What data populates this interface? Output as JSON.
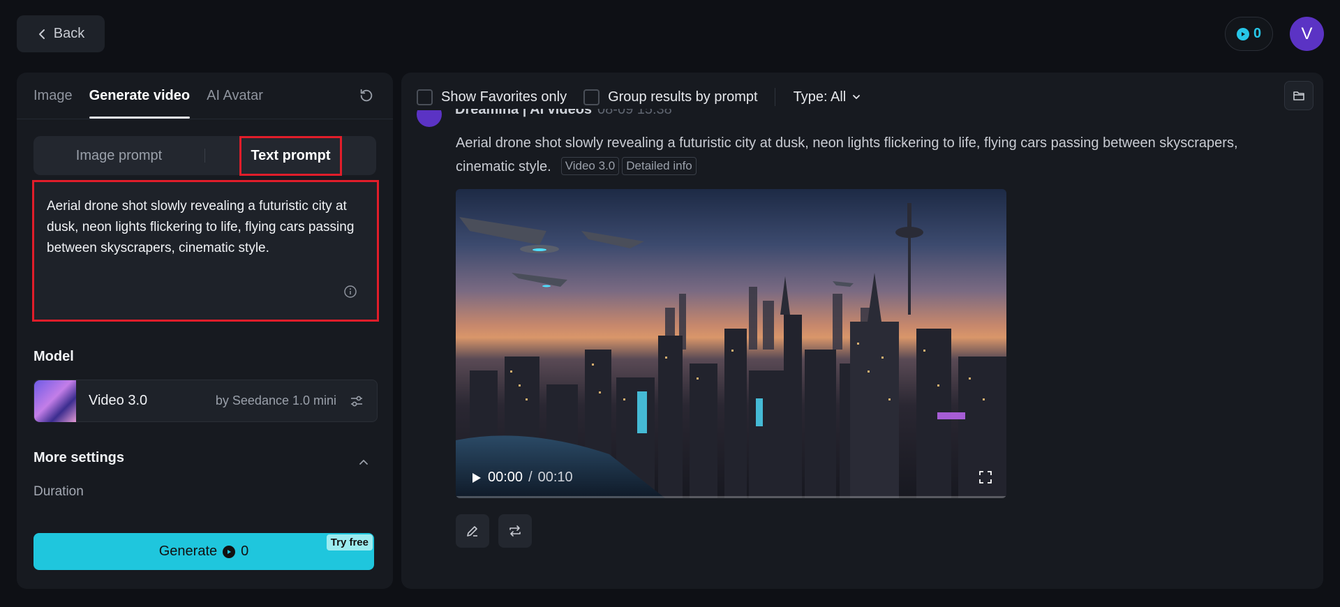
{
  "topbar": {
    "back_label": "Back",
    "credits": "0",
    "avatar_letter": "V"
  },
  "left": {
    "tabs": [
      {
        "label": "Image",
        "active": false
      },
      {
        "label": "Generate video",
        "active": true
      },
      {
        "label": "AI Avatar",
        "active": false
      }
    ],
    "prompt_modes": [
      {
        "label": "Image prompt",
        "active": false
      },
      {
        "label": "Text prompt",
        "active": true
      }
    ],
    "prompt_text": "Aerial drone shot slowly revealing a futuristic city at dusk, neon lights flickering to life, flying cars passing between skyscrapers, cinematic style.",
    "model_section_label": "Model",
    "model": {
      "name": "Video 3.0",
      "by": "by Seedance 1.0 mini"
    },
    "more_settings_label": "More settings",
    "duration_label": "Duration",
    "generate": {
      "label": "Generate",
      "cost": "0",
      "badge": "Try free"
    }
  },
  "right": {
    "toolbar": {
      "favorites_label": "Show Favorites only",
      "group_label": "Group results by prompt",
      "type_label": "Type: All"
    },
    "result": {
      "author": "Dreamina | AI videos",
      "timestamp": "08-09 15:38",
      "prompt": "Aerial drone shot slowly revealing a futuristic city at dusk, neon lights flickering to life, flying cars passing between skyscrapers, cinematic style.",
      "tags": [
        "Video 3.0",
        "Detailed info"
      ],
      "video": {
        "current_time": "00:00",
        "separator": "/",
        "duration": "00:10",
        "progress": 0
      }
    }
  },
  "colors": {
    "accent": "#1fc6dd",
    "highlight_border": "#e11d2a",
    "avatar": "#5b33c4"
  },
  "icons": [
    "chevron-left-icon",
    "credit-coin-icon",
    "refresh-icon",
    "info-icon",
    "sliders-icon",
    "chevron-up-icon",
    "chevron-down-icon",
    "folder-icon",
    "play-icon",
    "fullscreen-icon",
    "edit-icon",
    "repeat-icon"
  ]
}
